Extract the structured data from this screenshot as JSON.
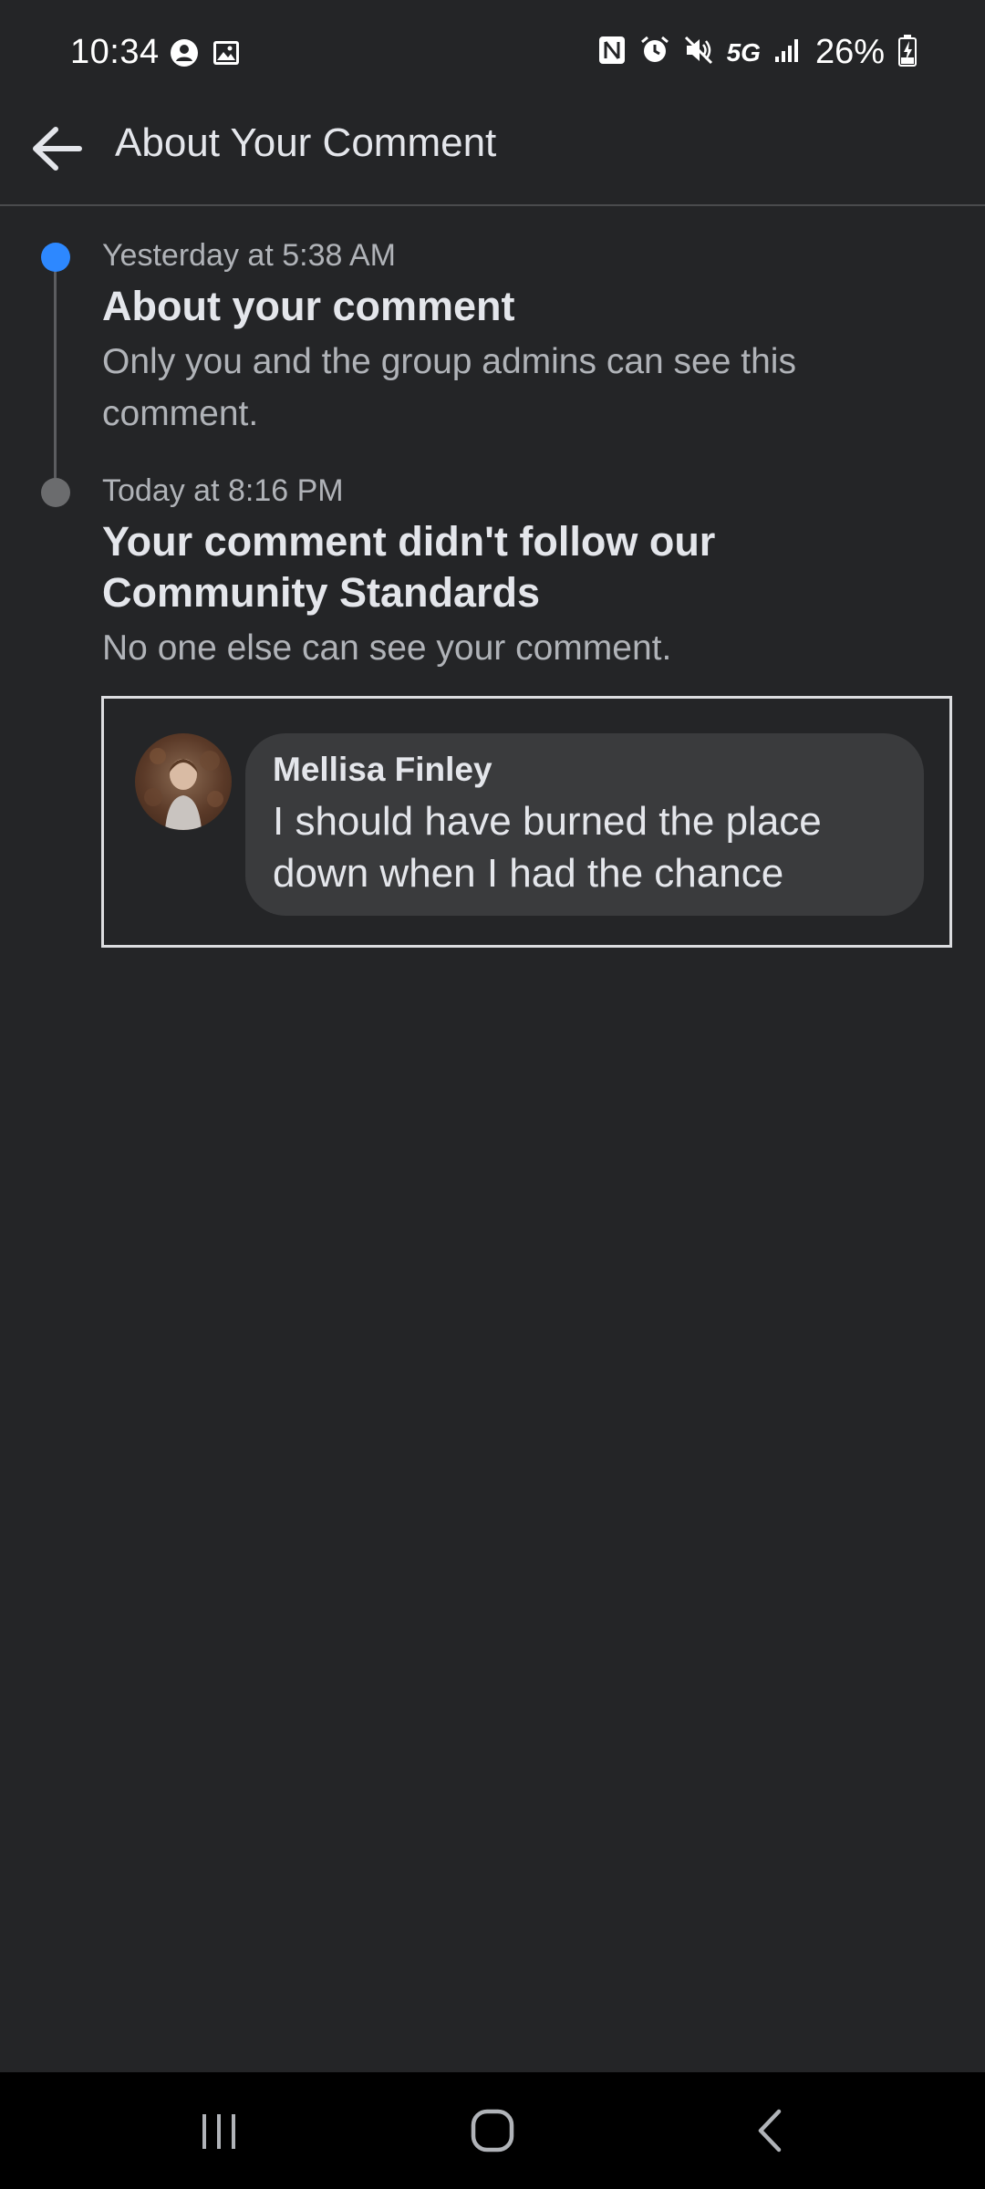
{
  "status_bar": {
    "time": "10:34",
    "network": "5G",
    "battery": "26%",
    "left_icons": [
      "account-circle-icon",
      "image-icon"
    ],
    "right_icons": [
      "nfc-icon",
      "alarm-icon",
      "mute-icon",
      "signal-icon",
      "battery-charging-icon"
    ]
  },
  "header": {
    "title": "About Your Comment",
    "back_icon": "arrow-left-icon"
  },
  "timeline": {
    "events": [
      {
        "time": "Yesterday at 5:38 AM",
        "title": "About your comment",
        "description": "Only you and the group admins can see this comment.",
        "dot_color": "#2d88ff"
      },
      {
        "time": "Today at 8:16 PM",
        "title": "Your comment didn't follow our Community Standards",
        "description": "No one else can see your comment.",
        "dot_color": "#6b6c6e"
      }
    ]
  },
  "comment": {
    "author": "Mellisa Finley",
    "text": "I should have burned the place down when I had the chance"
  },
  "nav_bar": {
    "buttons": [
      "recents-icon",
      "home-icon",
      "back-icon"
    ]
  },
  "colors": {
    "background": "#242527",
    "accent": "#2d88ff",
    "text_primary": "#e4e6eb",
    "text_secondary": "#b0b3b8",
    "bubble": "#3a3b3d"
  }
}
